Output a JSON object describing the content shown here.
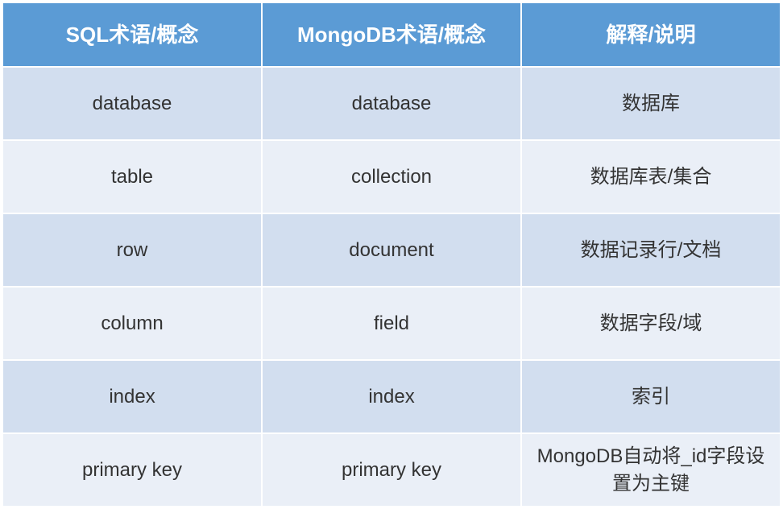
{
  "chart_data": {
    "type": "table",
    "headers": [
      "SQL术语/概念",
      "MongoDB术语/概念",
      "解释/说明"
    ],
    "rows": [
      {
        "sql": "database",
        "mongo": "database",
        "desc": "数据库"
      },
      {
        "sql": "table",
        "mongo": "collection",
        "desc": "数据库表/集合"
      },
      {
        "sql": "row",
        "mongo": "document",
        "desc": "数据记录行/文档"
      },
      {
        "sql": "column",
        "mongo": "field",
        "desc": "数据字段/域"
      },
      {
        "sql": "index",
        "mongo": "index",
        "desc": "索引"
      },
      {
        "sql": "primary key",
        "mongo": "primary key",
        "desc": "MongoDB自动将_id字段设置为主键"
      }
    ]
  }
}
